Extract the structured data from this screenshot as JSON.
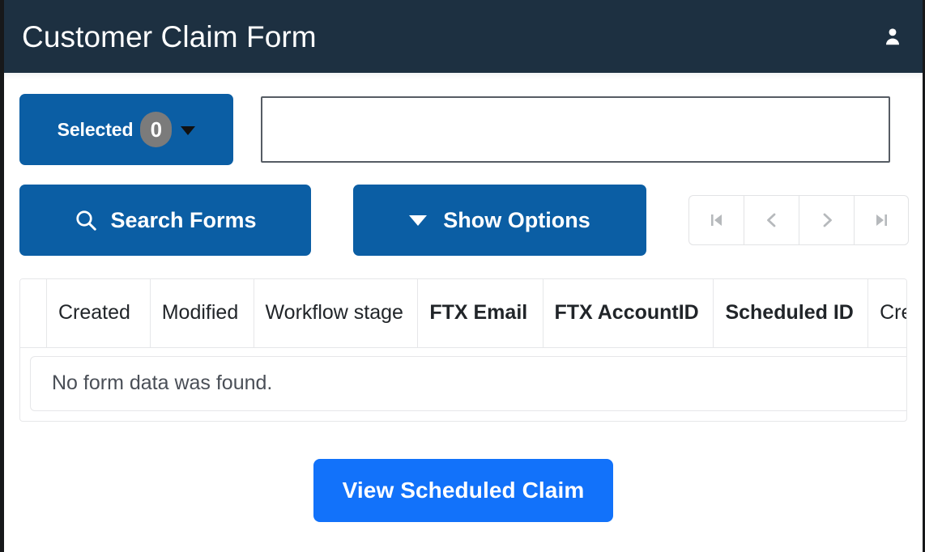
{
  "header": {
    "title": "Customer Claim Form",
    "user_icon": "user-icon"
  },
  "toolbar": {
    "selected_label": "Selected",
    "selected_count": "0",
    "selected_caret_icon": "chevron-down-icon",
    "search_input_value": "",
    "search_input_placeholder": "",
    "search_forms_label": "Search Forms",
    "search_icon": "search-icon",
    "show_options_label": "Show Options",
    "show_options_caret_icon": "chevron-down-icon"
  },
  "pagination": {
    "first_icon": "first-page-icon",
    "prev_icon": "chevron-left-icon",
    "next_icon": "chevron-right-icon",
    "last_icon": "last-page-icon"
  },
  "table": {
    "columns": [
      {
        "label": "",
        "bold": false
      },
      {
        "label": "Created",
        "bold": false
      },
      {
        "label": "Modified",
        "bold": false
      },
      {
        "label": "Workflow stage",
        "bold": false
      },
      {
        "label": "FTX Email",
        "bold": true
      },
      {
        "label": "FTX AccountID",
        "bold": true
      },
      {
        "label": "Scheduled ID",
        "bold": true
      },
      {
        "label": "Creditor",
        "bold": false
      }
    ],
    "empty_message": "No form data was found.",
    "rows": []
  },
  "footer": {
    "view_claim_label": "View Scheduled Claim"
  },
  "colors": {
    "header_bg": "#1d3041",
    "primary_dark_blue": "#0b5ea4",
    "bright_blue": "#1272fa",
    "badge_gray": "#7b7b7b",
    "border_gray": "#e6e7e9",
    "input_border": "#565c64",
    "text_dark": "#212529",
    "muted_text": "#4a4f57"
  }
}
